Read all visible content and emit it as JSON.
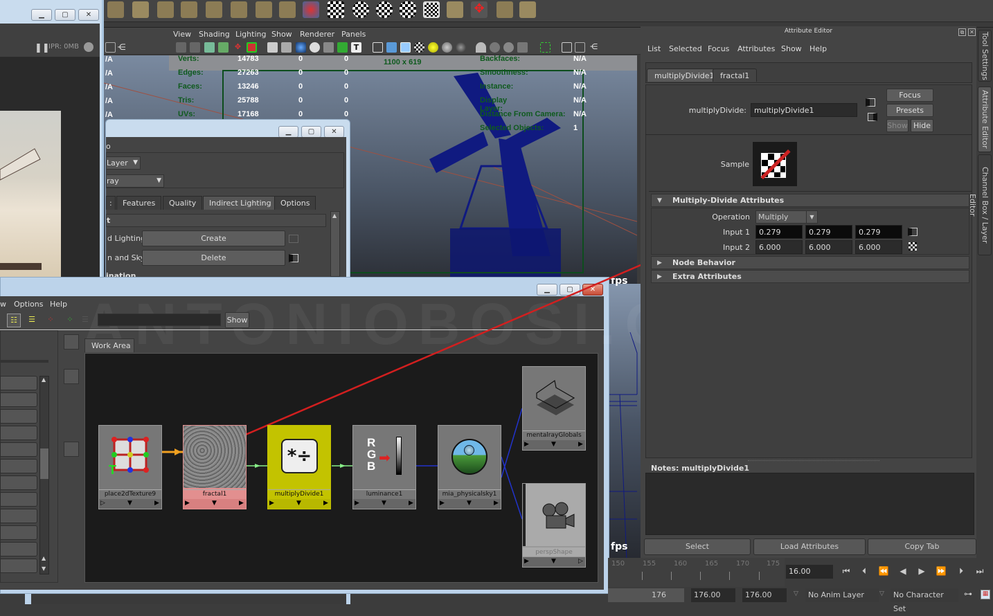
{
  "viewport": {
    "menu": [
      "View",
      "Shading",
      "Lighting",
      "Show",
      "Renderer",
      "Panels"
    ],
    "resolution_gate": "1100 x 619",
    "hud_left": [
      {
        "label": "Verts:",
        "v1": "14783",
        "v2": "0",
        "v3": "0"
      },
      {
        "label": "Edges:",
        "v1": "27263",
        "v2": "0",
        "v3": "0"
      },
      {
        "label": "Faces:",
        "v1": "13246",
        "v2": "0",
        "v3": "0"
      },
      {
        "label": "Tris:",
        "v1": "25788",
        "v2": "0",
        "v3": "0"
      },
      {
        "label": "UVs:",
        "v1": "17168",
        "v2": "0",
        "v3": "0"
      }
    ],
    "hud_right": [
      {
        "label": "Backfaces:",
        "value": "N/A"
      },
      {
        "label": "Smoothness:",
        "value": "N/A"
      },
      {
        "label": "Instance:",
        "value": "N/A"
      },
      {
        "label": "Display Layer:",
        "value": "N/A"
      },
      {
        "label": "Distance From Camera:",
        "value": "N/A"
      },
      {
        "label": "Selected Objects:",
        "value": "1"
      }
    ],
    "left_na": [
      "/A",
      "/A",
      "/A",
      "/A",
      "/A"
    ],
    "fps_label": "fps"
  },
  "render_view": {
    "ipr_label": "IPR: 0MB"
  },
  "render_settings": {
    "row1": "o",
    "layer_dropdown": "Layer",
    "renderer_dropdown": "ray",
    "tabs": [
      ":",
      "Features",
      "Quality",
      "Indirect Lighting",
      "Options"
    ],
    "active_tab": "Indirect Lighting",
    "section": "t",
    "rows": [
      {
        "label": "d Lighting",
        "button": "Create"
      },
      {
        "label": "n and Sky",
        "button": "Delete"
      }
    ],
    "cut_section": "ination"
  },
  "hypershade": {
    "menu": [
      "w",
      "Options",
      "Help"
    ],
    "show_button": "Show",
    "work_area_tab": "Work Area",
    "watermark": "ANTONIOBOSI.COM",
    "nodes": [
      {
        "name": "place2dTexture9"
      },
      {
        "name": "fractal1"
      },
      {
        "name": "multiplyDivide1"
      },
      {
        "name": "luminance1"
      },
      {
        "name": "mia_physicalsky1"
      },
      {
        "name": "mentalrayGlobals"
      },
      {
        "name": "perspShape"
      }
    ]
  },
  "attribute_editor": {
    "title": "Attribute Editor",
    "menu": [
      "List",
      "Selected",
      "Focus",
      "Attributes",
      "Show",
      "Help"
    ],
    "tabs": [
      "multiplyDivide1",
      "fractal1"
    ],
    "active_tab": "multiplyDivide1",
    "node_type_label": "multiplyDivide:",
    "node_name": "multiplyDivide1",
    "buttons": {
      "focus": "Focus",
      "presets": "Presets",
      "show": "Show",
      "hide": "Hide"
    },
    "sample_label": "Sample",
    "sections": [
      {
        "title": "Multiply-Divide Attributes",
        "expanded": true
      },
      {
        "title": "Node Behavior",
        "expanded": false
      },
      {
        "title": "Extra Attributes",
        "expanded": false
      }
    ],
    "operation_label": "Operation",
    "operation_value": "Multiply",
    "input1_label": "Input 1",
    "input1": [
      "0.279",
      "0.279",
      "0.279"
    ],
    "input2_label": "Input 2",
    "input2": [
      "6.000",
      "6.000",
      "6.000"
    ],
    "notes_label": "Notes:  multiplyDivide1",
    "bottom_buttons": [
      "Select",
      "Load Attributes",
      "Copy Tab"
    ]
  },
  "side_tabs": [
    "Tool Settings",
    "Attribute Editor",
    "Channel Box / Layer Editor"
  ],
  "timeline": {
    "ticks": [
      "150",
      "155",
      "160",
      "165",
      "170",
      "175"
    ],
    "current_frame": "16.00",
    "range_end_display": "176",
    "range_start": "176.00",
    "range_end": "176.00",
    "anim_layer": "No Anim Layer",
    "character_set": "No Character Set"
  },
  "colors": {
    "fractal_node": "#e28f8f",
    "multiply_node": "#c3c300",
    "annotation_arrow": "#d21f1f",
    "hud_green": "#0f5a1e"
  }
}
